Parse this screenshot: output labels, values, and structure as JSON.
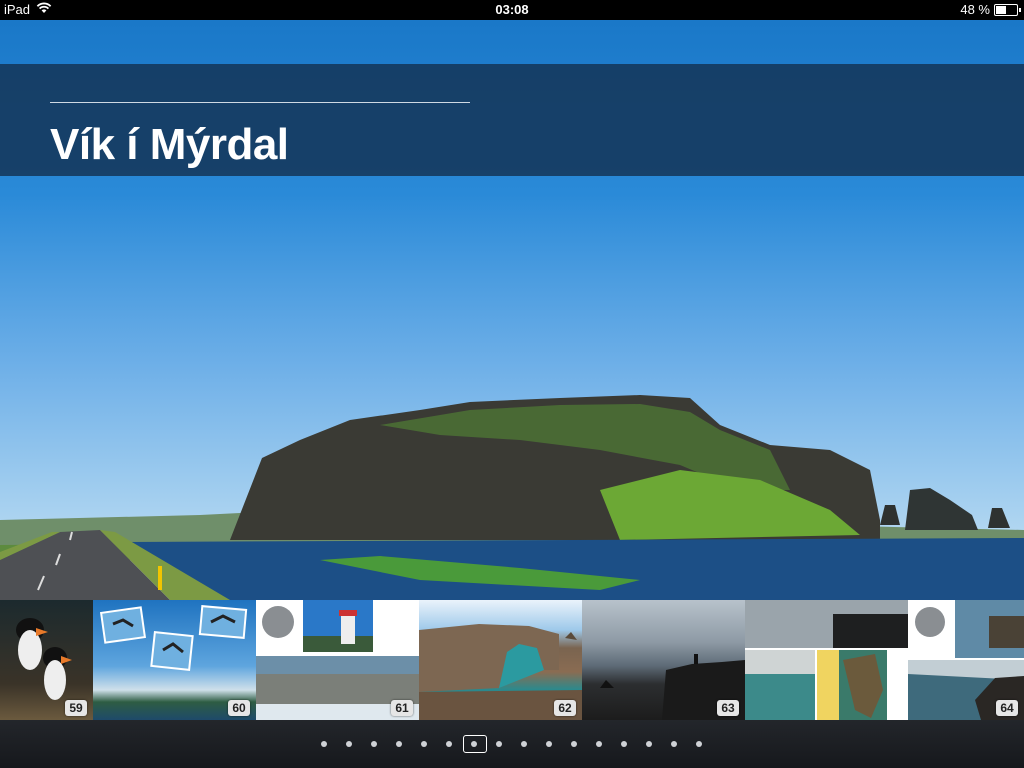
{
  "status_bar": {
    "device": "iPad",
    "time": "03:08",
    "battery_percent": "48 %",
    "battery_level": 0.48,
    "wifi_icon": "wifi-icon"
  },
  "hero": {
    "title": "Vík í Mýrdal",
    "image": "Coastal sea stack cliff landscape with road and lagoon under blue sky"
  },
  "thumbnails": [
    {
      "page": "59",
      "image": "puffins"
    },
    {
      "page": "60",
      "image": "birds collage over coast"
    },
    {
      "page": "61",
      "image": "lighthouse and cliffs layout"
    },
    {
      "page": "62",
      "image": "rock arch over sea"
    },
    {
      "page": "63",
      "image": "cliff silhouette at sea"
    },
    {
      "page": "64",
      "image": "black sand beach layout"
    }
  ],
  "pagination": {
    "count": 16,
    "active_index": 6
  }
}
